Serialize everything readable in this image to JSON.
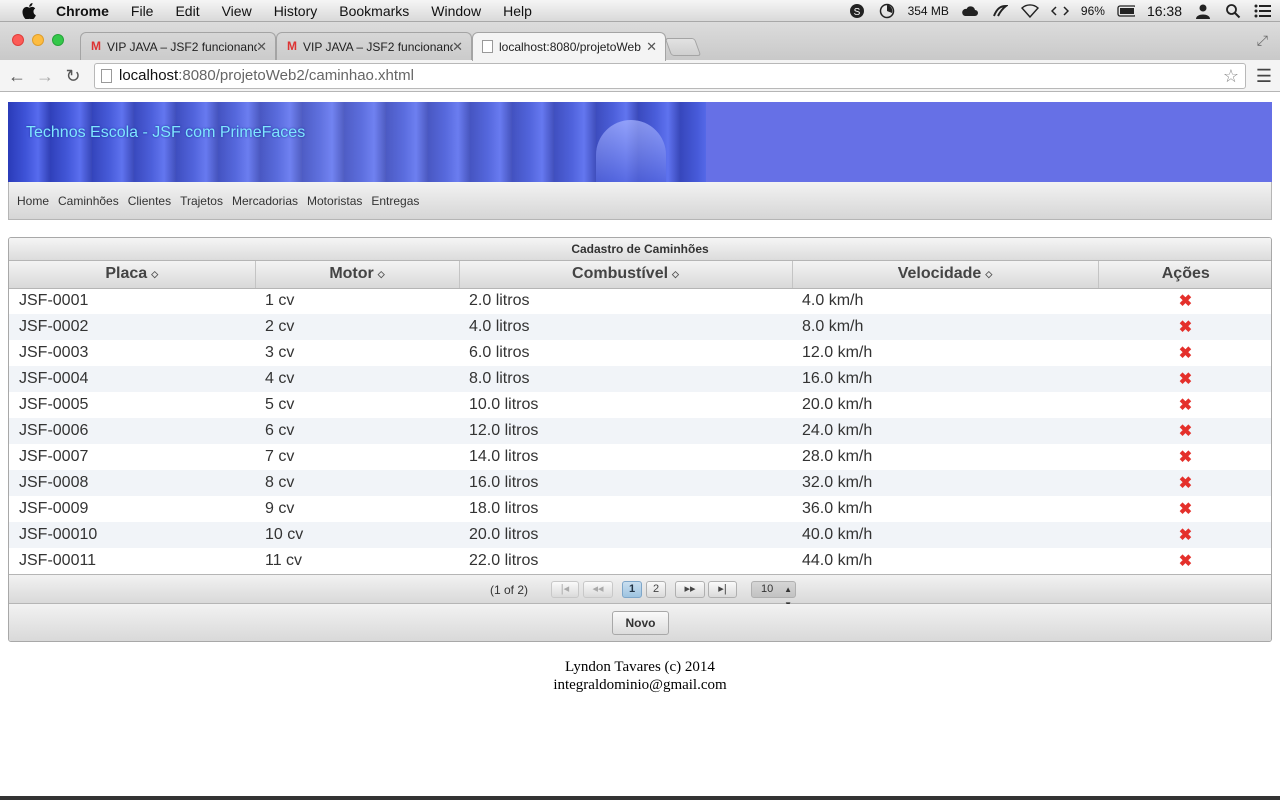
{
  "menubar": {
    "app": "Chrome",
    "items": [
      "File",
      "Edit",
      "View",
      "History",
      "Bookmarks",
      "Window",
      "Help"
    ],
    "memory": "354 MB",
    "battery": "96%",
    "clock": "16:38"
  },
  "tabs": [
    {
      "title": "VIP JAVA – JSF2 funcionand",
      "icon": "gmail-icon"
    },
    {
      "title": "VIP JAVA – JSF2 funcionand",
      "icon": "gmail-icon"
    },
    {
      "title": "localhost:8080/projetoWeb",
      "icon": "page-icon"
    }
  ],
  "address": {
    "host": "localhost",
    "rest": ":8080/projetoWeb2/caminhao.xhtml"
  },
  "banner": {
    "title": "Technos Escola - JSF com PrimeFaces"
  },
  "nav": [
    "Home",
    "Caminhões",
    "Clientes",
    "Trajetos",
    "Mercadorias",
    "Motoristas",
    "Entregas"
  ],
  "table": {
    "caption": "Cadastro de Caminhões",
    "columns": [
      "Placa",
      "Motor",
      "Combustível",
      "Velocidade",
      "Ações"
    ],
    "rows": [
      [
        "JSF-0001",
        "1 cv",
        "2.0 litros",
        "4.0 km/h"
      ],
      [
        "JSF-0002",
        "2 cv",
        "4.0 litros",
        "8.0 km/h"
      ],
      [
        "JSF-0003",
        "3 cv",
        "6.0 litros",
        "12.0 km/h"
      ],
      [
        "JSF-0004",
        "4 cv",
        "8.0 litros",
        "16.0 km/h"
      ],
      [
        "JSF-0005",
        "5 cv",
        "10.0 litros",
        "20.0 km/h"
      ],
      [
        "JSF-0006",
        "6 cv",
        "12.0 litros",
        "24.0 km/h"
      ],
      [
        "JSF-0007",
        "7 cv",
        "14.0 litros",
        "28.0 km/h"
      ],
      [
        "JSF-0008",
        "8 cv",
        "16.0 litros",
        "32.0 km/h"
      ],
      [
        "JSF-0009",
        "9 cv",
        "18.0 litros",
        "36.0 km/h"
      ],
      [
        "JSF-00010",
        "10 cv",
        "20.0 litros",
        "40.0 km/h"
      ],
      [
        "JSF-00011",
        "11 cv",
        "22.0 litros",
        "44.0 km/h"
      ]
    ],
    "action_icon": "delete-icon",
    "action_color": "#e4302b"
  },
  "paginator": {
    "info": "(1 of 2)",
    "pages": [
      "1",
      "2"
    ],
    "rows_per_page": "10"
  },
  "buttons": {
    "new": "Novo"
  },
  "footer": {
    "line1": "Lyndon Tavares (c) 2014",
    "line2": "integraldominio@gmail.com"
  }
}
